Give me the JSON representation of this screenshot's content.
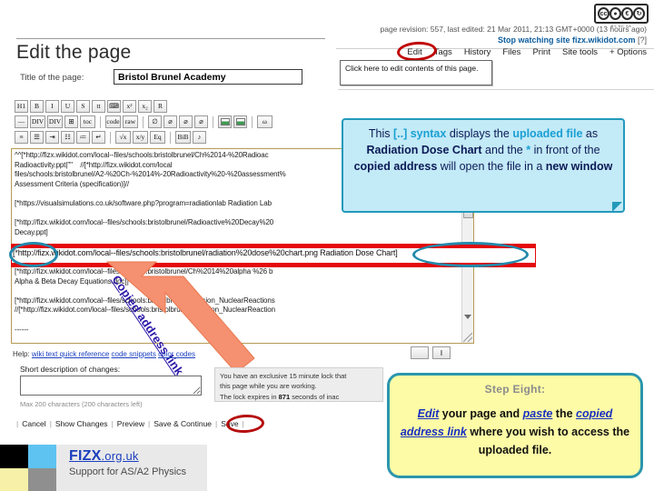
{
  "meta": {
    "revision_line": "page revision: 557, last edited: 21 Mar 2011, 21:13 GMT+0000 (13 hours ago)",
    "watch_prefix": "Stop watching site ",
    "watch_site": "fizx.wikidot.com",
    "watch_suffix": " [?]",
    "cc_letters": [
      "CC",
      "BY",
      "NC",
      "SA"
    ],
    "cc_sub": "BY    NC    SA"
  },
  "tabs": [
    {
      "label": "Edit",
      "name": "tab-edit"
    },
    {
      "label": "Tags",
      "name": "tab-tags"
    },
    {
      "label": "History",
      "name": "tab-history"
    },
    {
      "label": "Files",
      "name": "tab-files"
    },
    {
      "label": "Print",
      "name": "tab-print"
    },
    {
      "label": "Site tools",
      "name": "tab-site-tools"
    },
    {
      "label": "+ Options",
      "name": "tab-options"
    }
  ],
  "tooltip": {
    "text": "Click here to edit contents of this page."
  },
  "heading": "Edit the page",
  "title_field": {
    "label": "Title of the page:",
    "value": "Bristol Brunel Academy"
  },
  "toolbar": {
    "row0": [
      "H1",
      "B",
      "I",
      "U",
      "S",
      "tt",
      "⌨",
      "x²",
      "x₂",
      "R"
    ],
    "row1": [
      "—",
      "DIV",
      "DIV",
      "⊞",
      "toc",
      "|",
      "code",
      "raw",
      "|",
      "∅",
      "⌀",
      "⌀",
      "⌀",
      "|",
      "img",
      "img",
      "|",
      "ω"
    ],
    "row2": [
      "≡",
      "☰",
      "⇥",
      "☷",
      "≔",
      "↵",
      "|",
      "√x",
      "x/y",
      "Eq",
      "|",
      "BiB",
      "♪"
    ]
  },
  "editor": {
    "content": "^^[*http://fizx.wikidot.com/local--files/schools:bristolbrunel/Ch%2014-%20Radioac\nRadioactivity.ppt|\"\"    //[*http://fizx.wikidot.com/local\nfiles/schools:bristolbrunel/A2-%20Ch-%2014%-20Radioactivity%20-%20assessment%\nAssessment Criteria (specification)]//\n\n[*https://visualsimulations.co.uk/software.php?program=radiationlab Radiation Lab\n\n[*http://fizx.wikidot.com/local--files/schools:bristolbrunel/Radioactive%20Decay%20\nDecay.ppt]",
    "content_after": "[*http://fizx.wikidot.com/local--files/schools:bristolbrunel/Ch%2014%20alpha %26 b\nAlpha & Beta Decay Equations.doc]]\n\n[*http://fizx.wikidot.com/local--files/schools:bristolbrunel/Revision_NuclearReactions\n//[*http://fizx.wikidot.com/local--files/schools:bristolbrunel/Revision_NuclearReaction\n\n------",
    "highlighted_line": "[*http://fizx.wikidot.com/local--files/schools:bristolbrunel/radiation%20dose%20chart.png Radiation Dose Chart]"
  },
  "annotations": {
    "arrow_label": "Copied address link",
    "edit_circle": "edit-highlight-circle",
    "save_circle": "save-highlight-circle",
    "ellipse_star": "star-prefix-ellipse",
    "ellipse_name": "display-name-ellipse"
  },
  "help": {
    "prefix": "Help: ",
    "links": [
      "wiki text quick reference",
      "code snippets",
      "color codes"
    ]
  },
  "changes": {
    "label": "Short description of changes:",
    "value": "",
    "hint": "Max 200 characters (200 characters left)"
  },
  "buttons": [
    {
      "label": "Cancel",
      "name": "cancel-button"
    },
    {
      "label": "Show Changes",
      "name": "show-changes-button"
    },
    {
      "label": "Preview",
      "name": "preview-button"
    },
    {
      "label": "Save & Continue",
      "name": "save-continue-button"
    },
    {
      "label": "Save",
      "name": "save-button"
    }
  ],
  "lock_notice": {
    "line1": "You have an exclusive 15 minute lock that",
    "line2": "this page while you are working.",
    "line3_pre": "The lock expires in ",
    "line3_num": "871",
    "line3_post": " seconds of inac"
  },
  "callout": {
    "seg1": "This ",
    "seg2": "[..] syntax",
    "seg3": " displays the ",
    "seg4": "uploaded file",
    "seg5": " as ",
    "seg6": "Radiation Dose Chart",
    "seg7": " and the ",
    "seg8": "*",
    "seg9": " in front of the ",
    "seg10": "copied address",
    "seg11": " will open the file in a ",
    "seg12": "new window"
  },
  "step": {
    "title": "Step Eight:",
    "part1": "Edit",
    "part2": " your page and ",
    "part3": "paste",
    "part4": " the ",
    "part5": "copied address link",
    "part6": " where you wish to access the uploaded file."
  },
  "footer": {
    "brand": "FIZX",
    "domain": ".org.uk",
    "tagline": "Support for AS/A2 Physics"
  },
  "colors": {
    "callout_bg": "#c3eaf7",
    "callout_border": "#2399bb",
    "step_bg": "#fdfba6",
    "step_border": "#2b96ad",
    "highlight_red": "#e4080a",
    "annotation_blue": "#2389ab",
    "circle_red": "#c00000",
    "arrow_orange": "#f59070",
    "link_blue": "#1a3fbf"
  }
}
